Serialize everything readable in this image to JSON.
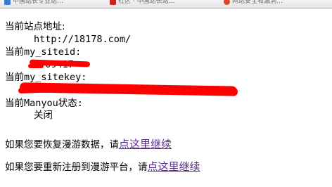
{
  "bookmarks": [
    {
      "label": "中国站长专业站…",
      "icon": "site-favicon",
      "color": "#3a7bd5"
    },
    {
      "label": "社区 · 中国站长站…",
      "icon": "site-favicon",
      "color": "#c8281e"
    },
    {
      "label": "网站安全和漏洞…",
      "icon": "site-favicon",
      "color": "#d9442a"
    }
  ],
  "site_info": {
    "site_url_label": "当前站点地址:",
    "site_url_value": "http://18178.com/",
    "siteid_label": "当前my_siteid:",
    "siteid_value": "??09417",
    "sitekey_label": "当前my_sitekey:",
    "manyou_status_label": "当前Manyou状态:",
    "manyou_status_value": "关闭"
  },
  "actions": {
    "restore_text": "如果您要恢复漫游数据，请",
    "restore_link": "点这里继续",
    "reregister_text": "如果您要重新注册到漫游平台，请",
    "reregister_link": "点这里继续"
  },
  "colors": {
    "redaction": "#ff0000",
    "link_visited": "#5b2d8e"
  }
}
